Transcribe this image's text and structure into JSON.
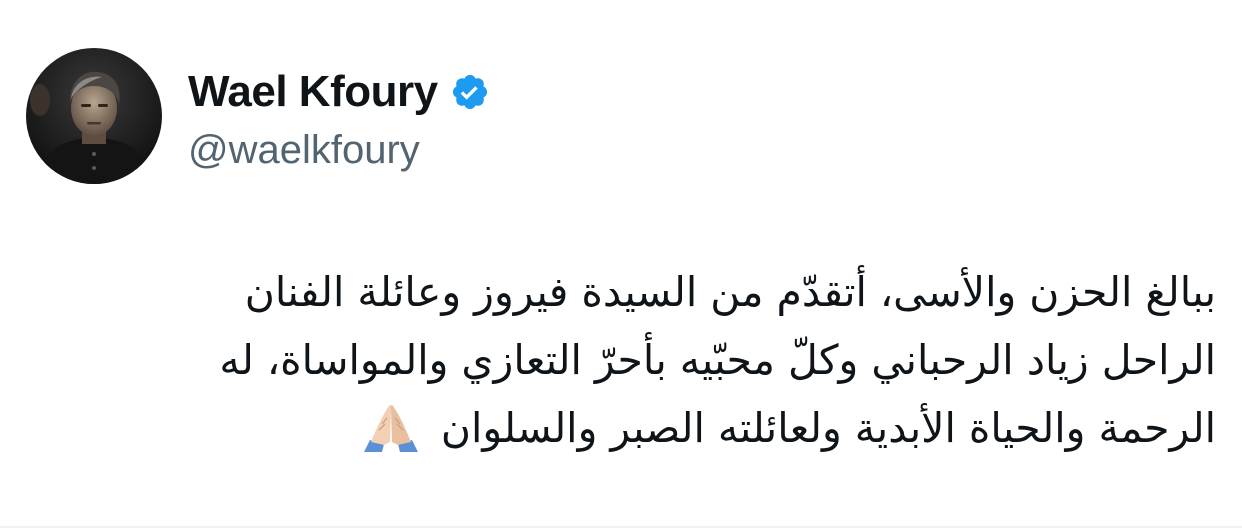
{
  "author": {
    "display_name": "Wael Kfoury",
    "handle": "@waelkfoury",
    "verified": true,
    "avatar_icon": "profile-photo",
    "badge_icon": "verified-check-icon",
    "badge_color": "#1d9bf0"
  },
  "tweet": {
    "lines": [
      "ببالغ الحزن والأسى، أتقدّم من السيدة فيروز وعائلة الفنان",
      "الراحل زياد الرحباني وكلّ محبّيه بأحرّ التعازي والمواساة، له",
      "الرحمة والحياة الأبدية ولعائلته الصبر والسلوان"
    ],
    "emoji_icon": "folded-hands-icon"
  },
  "colors": {
    "text_primary": "#0f1419",
    "text_secondary": "#536471",
    "background": "#ffffff"
  }
}
